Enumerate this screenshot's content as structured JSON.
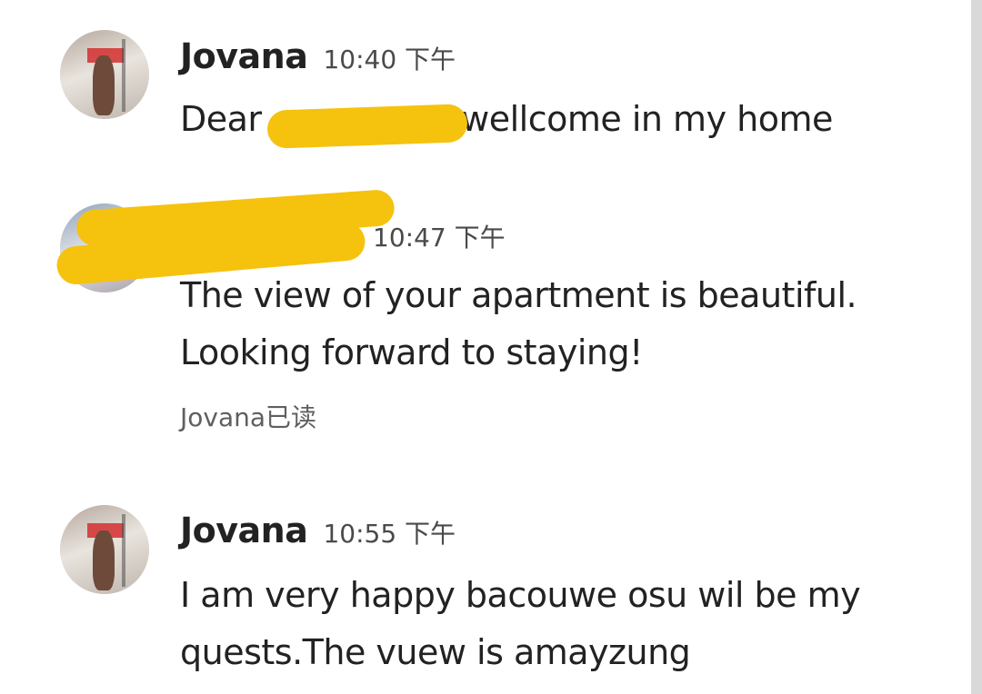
{
  "messages": [
    {
      "sender": "Jovana",
      "time": "10:40 下午",
      "text_before": "Dear ",
      "text_after": "wellcome in my home"
    },
    {
      "sender": "",
      "time": "10:47 下午",
      "lines": [
        "The view of your apartment is beautiful.",
        "Looking forward to staying!"
      ],
      "read_receipt": "Jovana已读"
    },
    {
      "sender": "Jovana",
      "time": "10:55 下午",
      "lines": [
        "I am very happy bacouwe osu wil be my",
        "quests.The vuew is amayzung"
      ]
    }
  ],
  "colors": {
    "redaction": "#f5c20e",
    "text": "#222222",
    "muted": "#5f5f5f"
  }
}
